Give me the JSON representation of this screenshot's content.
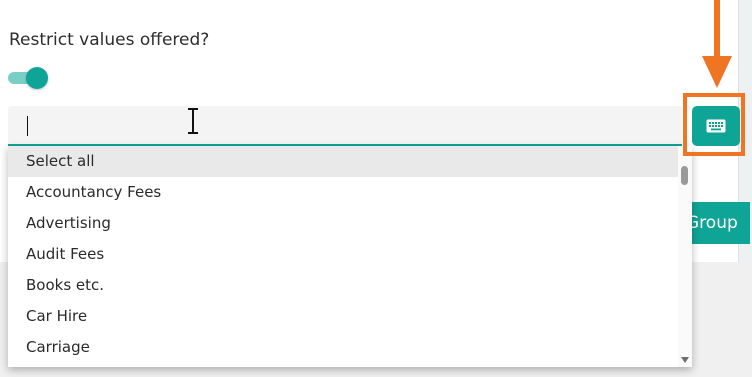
{
  "restrict": {
    "label": "Restrict values offered?",
    "toggle_on": true
  },
  "search": {
    "value": "",
    "placeholder": ""
  },
  "colors": {
    "accent": "#0fa596",
    "highlight": "#f07522"
  },
  "keyboard_button": {
    "icon": "keyboard-icon"
  },
  "group_button": {
    "label": "Group"
  },
  "dropdown": {
    "items": [
      {
        "label": "Select all",
        "selected": true
      },
      {
        "label": "Accountancy Fees"
      },
      {
        "label": "Advertising"
      },
      {
        "label": "Audit Fees"
      },
      {
        "label": "Books etc."
      },
      {
        "label": "Car Hire"
      },
      {
        "label": "Carriage"
      }
    ]
  }
}
